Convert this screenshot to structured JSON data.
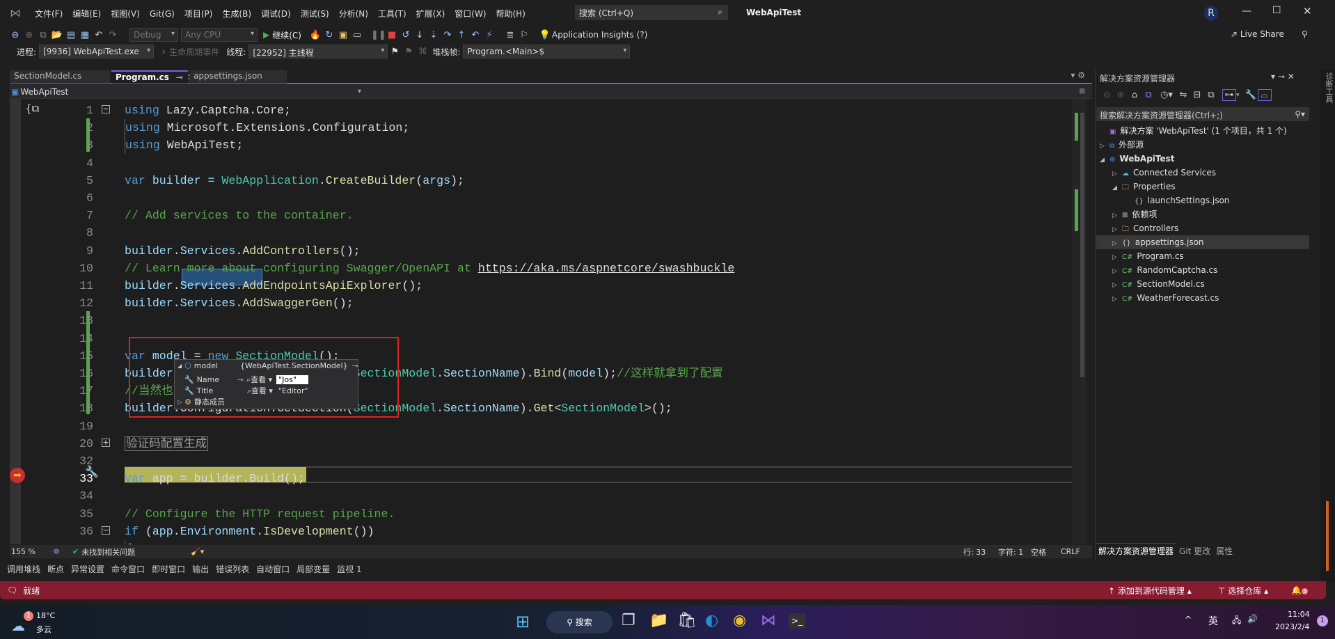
{
  "window": {
    "title": "WebApiTest",
    "user_initial": "R",
    "search_placeholder": "搜索 (Ctrl+Q)",
    "live_share": "Live Share"
  },
  "menu": [
    "文件(F)",
    "编辑(E)",
    "视图(V)",
    "Git(G)",
    "项目(P)",
    "生成(B)",
    "调试(D)",
    "测试(S)",
    "分析(N)",
    "工具(T)",
    "扩展(X)",
    "窗口(W)",
    "帮助(H)"
  ],
  "toolbar": {
    "config": "Debug",
    "platform": "Any CPU",
    "continue": "继续(C)",
    "app_insights": "Application Insights (?)"
  },
  "debugbar": {
    "process_label": "进程:",
    "process": "[9936] WebApiTest.exe",
    "lifecycle": "生命周期事件",
    "thread_label": "线程:",
    "thread": "[22952] 主线程",
    "stack_label": "堆栈帧:",
    "stack": "Program.<Main>$"
  },
  "tabs": [
    {
      "label": "SectionModel.cs",
      "active": false
    },
    {
      "label": "Program.cs",
      "active": true
    },
    {
      "label": "appsettings.json",
      "active": false
    }
  ],
  "navbar": {
    "project": "WebApiTest"
  },
  "code": [
    {
      "n": "1",
      "t": [
        [
          "using",
          "kw"
        ],
        [
          " Lazy.Captcha.Core;",
          "ln2"
        ]
      ]
    },
    {
      "n": "2",
      "t": [
        [
          "using",
          "kw"
        ],
        [
          " Microsoft.Extensions.Configuration;",
          "ln2"
        ]
      ]
    },
    {
      "n": "3",
      "t": [
        [
          "using",
          "kw"
        ],
        [
          " WebApiTest;",
          "ln2"
        ]
      ]
    },
    {
      "n": "4",
      "t": []
    },
    {
      "n": "5",
      "t": [
        [
          "var",
          "kw"
        ],
        [
          " builder = ",
          "va"
        ],
        [
          "WebApplication",
          "ty"
        ],
        [
          ".",
          "ln2"
        ],
        [
          "CreateBuilder",
          "me"
        ],
        [
          "(",
          "ln2"
        ],
        [
          "args",
          "va"
        ],
        [
          ");",
          "ln2"
        ]
      ]
    },
    {
      "n": "6",
      "t": []
    },
    {
      "n": "7",
      "t": [
        [
          "// Add services to the container.",
          "cm"
        ]
      ]
    },
    {
      "n": "8",
      "t": []
    },
    {
      "n": "9",
      "t": [
        [
          "builder",
          "va"
        ],
        [
          ".",
          "ln2"
        ],
        [
          "Services",
          "va"
        ],
        [
          ".",
          "ln2"
        ],
        [
          "AddControllers",
          "me"
        ],
        [
          "();",
          "ln2"
        ]
      ]
    },
    {
      "n": "10",
      "t": [
        [
          "// Learn more about configuring Swagger/OpenAPI at ",
          "cm"
        ],
        [
          "https://aka.ms/aspnetcore/swashbuckle",
          "url"
        ]
      ]
    },
    {
      "n": "11",
      "t": [
        [
          "builder",
          "va"
        ],
        [
          ".",
          "ln2"
        ],
        [
          "Services",
          "va"
        ],
        [
          ".",
          "ln2"
        ],
        [
          "AddEndpointsApiExplorer",
          "me"
        ],
        [
          "();",
          "ln2"
        ]
      ]
    },
    {
      "n": "12",
      "t": [
        [
          "builder",
          "va"
        ],
        [
          ".",
          "ln2"
        ],
        [
          "Services",
          "va"
        ],
        [
          ".",
          "ln2"
        ],
        [
          "AddSwaggerGen",
          "me"
        ],
        [
          "();",
          "ln2"
        ]
      ]
    },
    {
      "n": "13",
      "t": []
    },
    {
      "n": "14",
      "t": []
    },
    {
      "n": "15",
      "t": [
        [
          "var",
          "kw"
        ],
        [
          " model",
          "va"
        ],
        [
          " = ",
          "ln2"
        ],
        [
          "new",
          "kw"
        ],
        [
          " SectionModel",
          "ty"
        ],
        [
          "();",
          "ln2"
        ]
      ]
    },
    {
      "n": "16",
      "t": [
        [
          "builder",
          "va"
        ],
        [
          ".Configuration.GetSection(",
          "ln2"
        ],
        [
          "SectionModel",
          "ty"
        ],
        [
          ".",
          "ln2"
        ],
        [
          "SectionName",
          "va"
        ],
        [
          ").",
          "ln2"
        ],
        [
          "Bind",
          "me"
        ],
        [
          "(",
          "ln2"
        ],
        [
          "model",
          "va"
        ],
        [
          ");",
          "ln2"
        ],
        [
          "//这样就拿到了配置",
          "cm"
        ]
      ]
    },
    {
      "n": "17",
      "t": [
        [
          "//当然也可以这样",
          "cm"
        ]
      ]
    },
    {
      "n": "18",
      "t": [
        [
          "builder",
          "va"
        ],
        [
          ".Configuration.GetSection(",
          "ln2"
        ],
        [
          "SectionModel",
          "ty"
        ],
        [
          ".",
          "ln2"
        ],
        [
          "SectionName",
          "va"
        ],
        [
          ").",
          "ln2"
        ],
        [
          "Get",
          "me"
        ],
        [
          "<",
          "ln2"
        ],
        [
          "SectionModel",
          "ty"
        ],
        [
          ">();",
          "ln2"
        ]
      ]
    },
    {
      "n": "19",
      "t": []
    },
    {
      "n": "20",
      "t": [
        [
          "验证码配置生成",
          "col"
        ]
      ]
    },
    {
      "n": "32",
      "t": []
    },
    {
      "n": "33",
      "t": [
        [
          "var",
          "kw"
        ],
        [
          " app = builder.Build();",
          "ln2"
        ]
      ]
    },
    {
      "n": "34",
      "t": []
    },
    {
      "n": "35",
      "t": [
        [
          "// Configure the HTTP request pipeline.",
          "cm"
        ]
      ]
    },
    {
      "n": "36",
      "t": [
        [
          "if",
          "kw"
        ],
        [
          " (",
          "ln2"
        ],
        [
          "app",
          "va"
        ],
        [
          ".",
          "ln2"
        ],
        [
          "Environment",
          "va"
        ],
        [
          ".",
          "ln2"
        ],
        [
          "IsDevelopment",
          "me"
        ],
        [
          "())",
          "ln2"
        ]
      ]
    },
    {
      "n": "37",
      "t": [
        [
          "{",
          "ln2"
        ]
      ]
    }
  ],
  "datatip": {
    "name": "model",
    "value": "{WebApiTest.SectionModel}",
    "view": "查看",
    "rows": [
      {
        "name": "Name",
        "value": "\"Jos\""
      },
      {
        "name": "Title",
        "value": "\"Editor\""
      }
    ],
    "static": "静态成员"
  },
  "editor_status": {
    "zoom": "155 %",
    "issues": "未找到相关问题",
    "line": "行: 33",
    "char": "字符: 1",
    "spaces": "空格",
    "eol": "CRLF"
  },
  "tool_tabs": [
    "调用堆栈",
    "断点",
    "异常设置",
    "命令窗口",
    "即时窗口",
    "输出",
    "错误列表",
    "自动窗口",
    "局部变量",
    "监视 1"
  ],
  "statusbar": {
    "ready": "就绪",
    "source_control": "添加到源代码管理",
    "repo": "选择仓库",
    "notifications": "3"
  },
  "solution_explorer": {
    "title": "解决方案资源管理器",
    "search": "搜索解决方案资源管理器(Ctrl+;)",
    "side_tab": "诊断工具",
    "items": [
      {
        "label": "解决方案 'WebApiTest' (1 个项目，共 1 个)",
        "depth": 0,
        "arrow": "",
        "icon": "solution-icon"
      },
      {
        "label": "外部源",
        "depth": 0,
        "arrow": "▷",
        "icon": "external-icon"
      },
      {
        "label": "WebApiTest",
        "depth": 0,
        "arrow": "◢",
        "icon": "web-project-icon",
        "bold": true
      },
      {
        "label": "Connected Services",
        "depth": 1,
        "arrow": "▷",
        "icon": "cloud-icon"
      },
      {
        "label": "Properties",
        "depth": 1,
        "arrow": "◢",
        "icon": "folder-wrench-icon"
      },
      {
        "label": "launchSettings.json",
        "depth": 2,
        "arrow": "",
        "icon": "json-icon"
      },
      {
        "label": "依赖项",
        "depth": 1,
        "arrow": "▷",
        "icon": "dependencies-icon"
      },
      {
        "label": "Controllers",
        "depth": 1,
        "arrow": "▷",
        "icon": "folder-icon"
      },
      {
        "label": "appsettings.json",
        "depth": 1,
        "arrow": "▷",
        "icon": "json-icon",
        "selected": true
      },
      {
        "label": "Program.cs",
        "depth": 1,
        "arrow": "▷",
        "icon": "csharp-icon"
      },
      {
        "label": "RandomCaptcha.cs",
        "depth": 1,
        "arrow": "▷",
        "icon": "csharp-icon"
      },
      {
        "label": "SectionModel.cs",
        "depth": 1,
        "arrow": "▷",
        "icon": "csharp-icon"
      },
      {
        "label": "WeatherForecast.cs",
        "depth": 1,
        "arrow": "▷",
        "icon": "csharp-icon"
      }
    ],
    "bottom_tabs": [
      "解决方案资源管理器",
      "Git 更改",
      "属性"
    ]
  },
  "taskbar": {
    "temp": "18°C",
    "weather": "多云",
    "weather_badge": "1",
    "search": "搜索",
    "ime": "英",
    "time": "11:04",
    "date": "2023/2/4",
    "notif": "1"
  }
}
